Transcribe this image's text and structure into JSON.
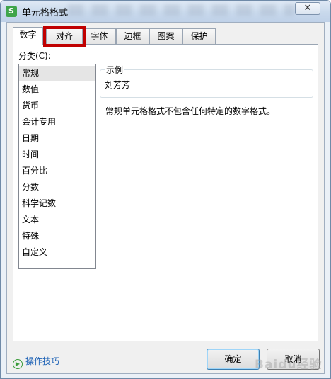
{
  "window": {
    "title": "单元格格式",
    "close_glyph": "✕"
  },
  "tabs": [
    {
      "label": "数字",
      "active": true
    },
    {
      "label": "对齐",
      "highlighted": true
    },
    {
      "label": "字体"
    },
    {
      "label": "边框"
    },
    {
      "label": "图案"
    },
    {
      "label": "保护"
    }
  ],
  "category": {
    "label": "分类(C):",
    "items": [
      "常规",
      "数值",
      "货币",
      "会计专用",
      "日期",
      "时间",
      "百分比",
      "分数",
      "科学记数",
      "文本",
      "特殊",
      "自定义"
    ],
    "selected": "常规"
  },
  "sample": {
    "title": "示例",
    "value": "刘芳芳"
  },
  "description": "常规单元格格式不包含任何特定的数字格式。",
  "footer": {
    "help_label": "操作技巧",
    "ok_label": "确定",
    "cancel_label": "取消"
  },
  "watermark": "Baidu经验",
  "colors": {
    "highlight_border": "#c00000",
    "link": "#1f63b6",
    "app_icon": "#3fa54a"
  },
  "icons": {
    "app": "wps-spreadsheet-icon",
    "help": "play-circle-icon"
  }
}
